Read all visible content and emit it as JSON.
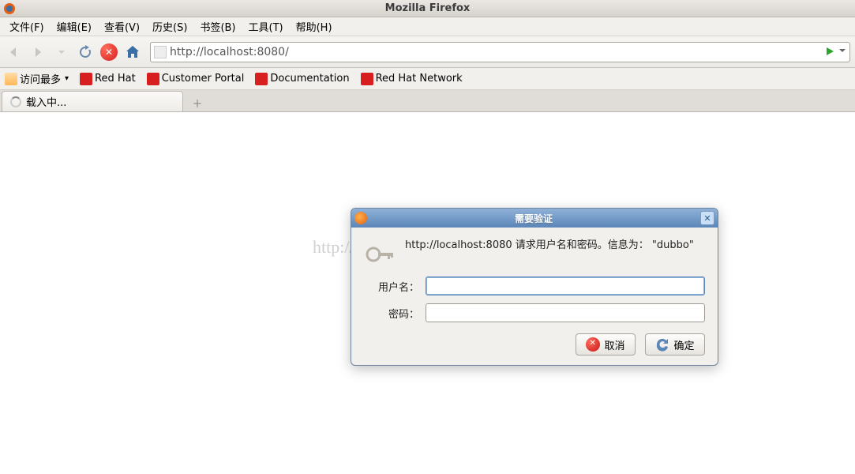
{
  "window": {
    "title": "Mozilla Firefox"
  },
  "menu": {
    "file": "文件(F)",
    "edit": "编辑(E)",
    "view": "查看(V)",
    "history": "历史(S)",
    "bookmarks": "书签(B)",
    "tools": "工具(T)",
    "help": "帮助(H)"
  },
  "toolbar": {
    "url": "http://localhost:8080/"
  },
  "bookmarks": {
    "most_visited": "访问最多",
    "redhat": "Red Hat",
    "customer_portal": "Customer Portal",
    "documentation": "Documentation",
    "redhat_network": "Red Hat Network"
  },
  "tab": {
    "loading_label": "载入中..."
  },
  "watermark": "http://blog.cs",
  "dialog": {
    "title": "需要验证",
    "message": "http://localhost:8080 请求用户名和密码。信息为： \"dubbo\"",
    "username_label": "用户名：",
    "password_label": "密码：",
    "username_value": "",
    "password_value": "",
    "cancel": "取消",
    "ok": "确定"
  }
}
